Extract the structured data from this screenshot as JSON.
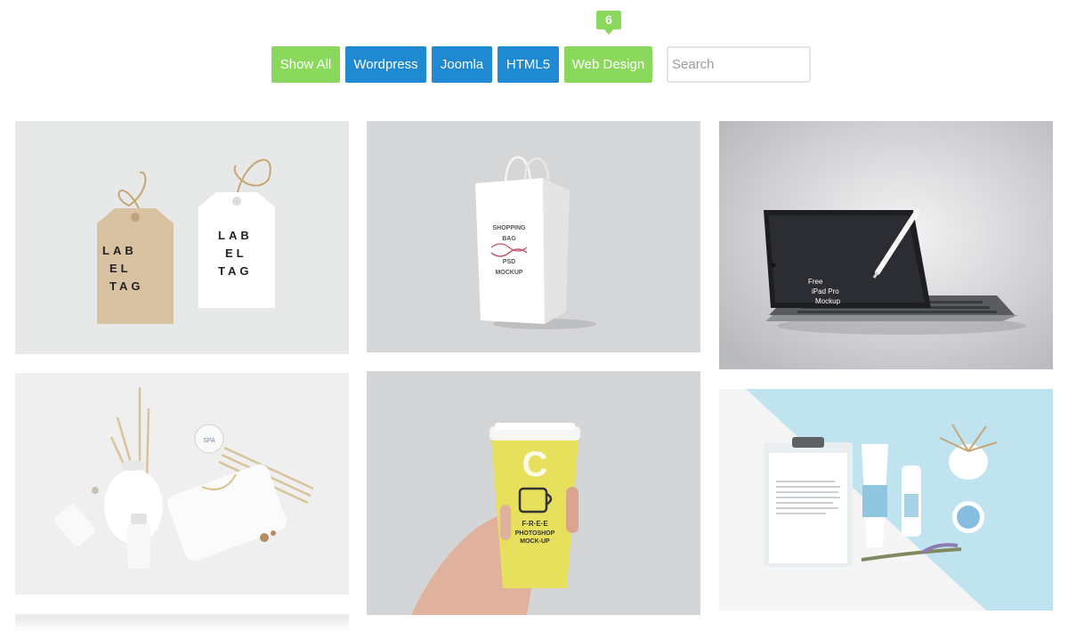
{
  "filters": {
    "badge_count": "6",
    "buttons": [
      "Show All",
      "Wordpress",
      "Joomla",
      "HTML5",
      "Web Design"
    ],
    "search_placeholder": "Search"
  },
  "gallery": {
    "label_tag": {
      "tag_a_lines": [
        "LAB",
        "EL",
        "TAG"
      ],
      "tag_b_lines": [
        "LAB",
        "EL",
        "TAG"
      ]
    },
    "shopping_bag": {
      "line1": "SHOPPING",
      "line2": "BAG",
      "line3": "PSD",
      "line4": "MOCKUP"
    },
    "ipad": {
      "line1": "Free",
      "line2": "iPad Pro",
      "line3": "Mockup"
    },
    "spa": {
      "jar_label": "SPA"
    },
    "coffee_cup": {
      "big_letter": "C",
      "line1": "F·R·E·E",
      "line2": "PHOTOSHOP",
      "line3": "MOCK-UP"
    }
  },
  "colors": {
    "green_button": "#8ad95c",
    "blue_button": "#1f8ad1",
    "cup_yellow": "#e6e05c",
    "stationery_blue": "#bfe4f0"
  }
}
